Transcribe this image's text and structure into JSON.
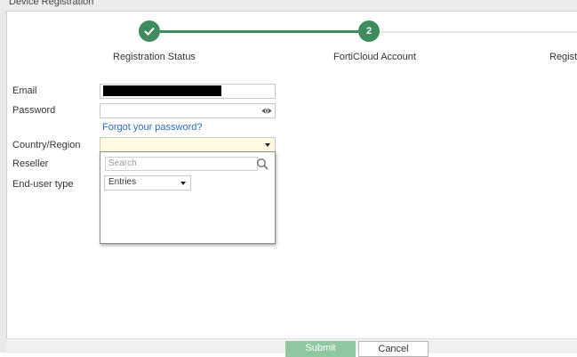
{
  "window": {
    "title": "Device Registration"
  },
  "steps": [
    {
      "label": "Registration Status",
      "number": "",
      "state": "complete"
    },
    {
      "label": "FortiCloud Account",
      "number": "2",
      "state": "active"
    },
    {
      "label": "Registr",
      "number": "",
      "state": "pending"
    }
  ],
  "form": {
    "email_label": "Email",
    "password_label": "Password",
    "forgot_password_link": "Forgot your password?",
    "country_label": "Country/Region",
    "reseller_label": "Reseller",
    "end_user_type_label": "End-user type"
  },
  "dropdown": {
    "search_placeholder": "Search",
    "entries_label": "Entries"
  },
  "buttons": {
    "submit": "Submit",
    "cancel": "Cancel"
  },
  "colors": {
    "accent": "#3e8b5e",
    "select_bg": "#fffbe1",
    "link": "#2a6ebb"
  }
}
